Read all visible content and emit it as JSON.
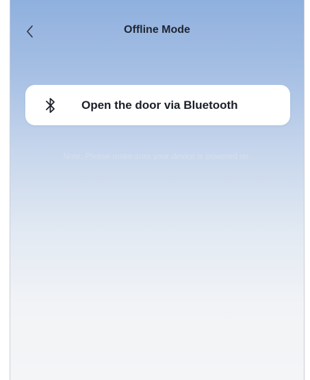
{
  "header": {
    "title": "Offline Mode",
    "back_icon": "chevron-left-icon"
  },
  "bluetooth_card": {
    "icon": "bluetooth-icon",
    "label": "Open the door via Bluetooth"
  },
  "note": "Note: Please make sure your device is powered on.",
  "colors": {
    "gradient_top": "#8fb0de",
    "gradient_bottom": "#f4f5f7",
    "card": "#ffffff",
    "title_text": "#1f2530",
    "note_text": "#d6dfee"
  }
}
